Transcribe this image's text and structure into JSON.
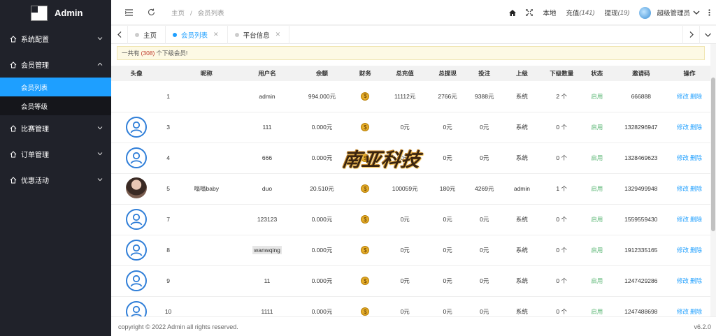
{
  "app": {
    "title": "Admin"
  },
  "sidebar": {
    "items": [
      {
        "label": "系统配置"
      },
      {
        "label": "会员管理"
      },
      {
        "label": "比赛管理"
      },
      {
        "label": "订单管理"
      },
      {
        "label": "优惠活动"
      }
    ],
    "sub": [
      {
        "label": "会员列表"
      },
      {
        "label": "会员等级"
      }
    ]
  },
  "header": {
    "breadcrumb_home": "主页",
    "breadcrumb_sep": "/",
    "breadcrumb_current": "会员列表",
    "local": "本地",
    "recharge": "充值",
    "recharge_count": "(141)",
    "withdraw": "提现",
    "withdraw_count": "(19)",
    "user": "超级管理员"
  },
  "tabs": [
    {
      "label": "主页"
    },
    {
      "label": "会员列表"
    },
    {
      "label": "平台信息"
    }
  ],
  "notice": {
    "prefix": "一共有",
    "count": "(308)",
    "suffix": "个下级会员!"
  },
  "table": {
    "headers": [
      "头像",
      "",
      "昵称",
      "用户名",
      "余额",
      "财务",
      "总充值",
      "总提现",
      "投注",
      "上级",
      "下级数量",
      "状态",
      "邀请码",
      "操作"
    ],
    "rows": [
      {
        "id": "1",
        "nick": "",
        "user": "admin",
        "bal": "994.000元",
        "rech": "11112元",
        "wd": "2766元",
        "bet": "9388元",
        "parent": "系统",
        "subs": "2 个",
        "status": "启用",
        "code": "666888",
        "avatar": "none"
      },
      {
        "id": "3",
        "nick": "",
        "user": "111",
        "bal": "0.000元",
        "rech": "0元",
        "wd": "0元",
        "bet": "0元",
        "parent": "系统",
        "subs": "0 个",
        "status": "启用",
        "code": "1328296947",
        "avatar": "default"
      },
      {
        "id": "4",
        "nick": "",
        "user": "666",
        "bal": "0.000元",
        "rech": "0元",
        "wd": "0元",
        "bet": "0元",
        "parent": "系统",
        "subs": "0 个",
        "status": "启用",
        "code": "1328469623",
        "avatar": "default"
      },
      {
        "id": "5",
        "nick": "嗡嗡baby",
        "user": "duo",
        "bal": "20.510元",
        "rech": "100059元",
        "wd": "180元",
        "bet": "4269元",
        "parent": "admin",
        "subs": "1 个",
        "status": "启用",
        "code": "1329499948",
        "avatar": "photo"
      },
      {
        "id": "7",
        "nick": "",
        "user": "123123",
        "bal": "0.000元",
        "rech": "0元",
        "wd": "0元",
        "bet": "0元",
        "parent": "系统",
        "subs": "0 个",
        "status": "启用",
        "code": "1559559430",
        "avatar": "default"
      },
      {
        "id": "8",
        "nick": "",
        "user": "wanwqing",
        "bal": "0.000元",
        "rech": "0元",
        "wd": "0元",
        "bet": "0元",
        "parent": "系统",
        "subs": "0 个",
        "status": "启用",
        "code": "1912335165",
        "avatar": "default"
      },
      {
        "id": "9",
        "nick": "",
        "user": "11",
        "bal": "0.000元",
        "rech": "0元",
        "wd": "0元",
        "bet": "0元",
        "parent": "系统",
        "subs": "0 个",
        "status": "启用",
        "code": "1247429286",
        "avatar": "default"
      },
      {
        "id": "10",
        "nick": "",
        "user": "1111",
        "bal": "0.000元",
        "rech": "0元",
        "wd": "0元",
        "bet": "0元",
        "parent": "系统",
        "subs": "0 个",
        "status": "启用",
        "code": "1247488698",
        "avatar": "default"
      }
    ],
    "edit": "修改",
    "delete": "删除",
    "coin": "$"
  },
  "watermark": "南亚科技",
  "footer": {
    "copyright": "copyright © 2022 Admin all rights reserved.",
    "version": "v6.2.0"
  },
  "colors": {
    "accent": "#1e9fff",
    "sidebar": "#20222a",
    "ok": "#5fb878"
  }
}
